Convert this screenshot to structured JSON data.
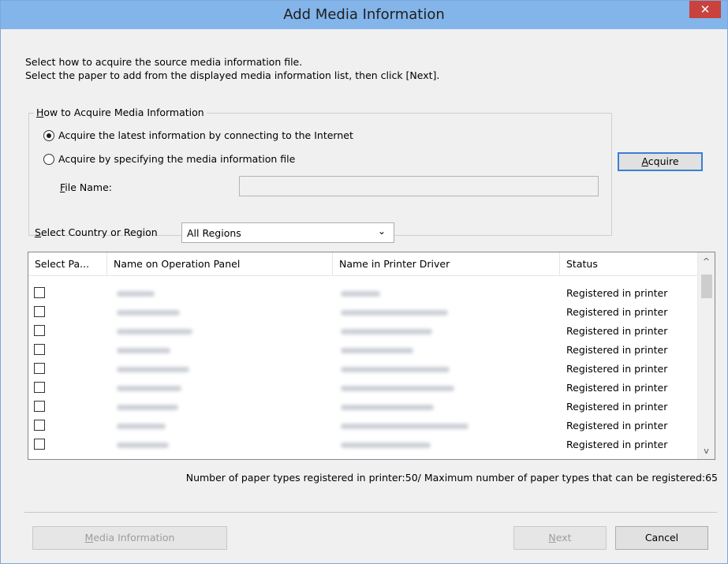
{
  "window": {
    "title": "Add Media Information",
    "close_glyph": "✕"
  },
  "instructions": {
    "line1": "Select how to acquire the source media information file.",
    "line2": "Select the paper to add from the displayed media information list, then click [Next]."
  },
  "acquire_group": {
    "legend_key": "H",
    "legend_rest": "ow to Acquire Media Information",
    "option_internet": "Acquire the latest information by connecting to the Internet",
    "option_file": "Acquire by specifying the media information file",
    "selected": "internet",
    "file_name_key": "F",
    "file_name_rest": "ile Name:",
    "file_name_value": ""
  },
  "acquire_button": {
    "key": "A",
    "rest": "cquire"
  },
  "region": {
    "label_key": "S",
    "label_rest": "elect Country or Region",
    "selected": "All Regions"
  },
  "list": {
    "columns": [
      "Select Pa...",
      "Name on Operation Panel",
      "Name in Printer Driver",
      "Status"
    ],
    "rows": [
      {
        "status": "Registered in printer"
      },
      {
        "status": "Registered in printer"
      },
      {
        "status": "Registered in printer"
      },
      {
        "status": "Registered in printer"
      },
      {
        "status": "Registered in printer"
      },
      {
        "status": "Registered in printer"
      },
      {
        "status": "Registered in printer"
      },
      {
        "status": "Registered in printer"
      },
      {
        "status": "Registered in printer"
      }
    ],
    "scroll_up": "^",
    "scroll_down": "v"
  },
  "summary": "Number of paper types registered in printer:50/ Maximum number of paper types that can be registered:65",
  "footer": {
    "media_info_key": "M",
    "media_info_rest": "edia Information",
    "next_key": "N",
    "next_rest": "ext",
    "cancel": "Cancel"
  }
}
